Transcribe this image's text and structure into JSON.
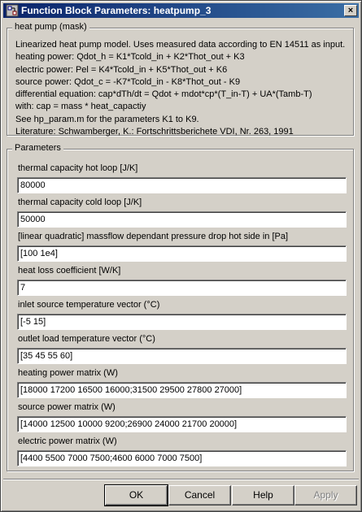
{
  "window": {
    "title": "Function Block Parameters: heatpump_3",
    "close_glyph": "×"
  },
  "mask": {
    "group_label": "heat pump (mask)",
    "description_lines": [
      "Linearized heat pump model. Uses measured data according to EN 14511 as input.",
      "heating power: Qdot_h = K1*Tcold_in + K2*Thot_out + K3",
      "electric power: Pel = K4*Tcold_in + K5*Thot_out + K6",
      "source power: Qdot_c = -K7*Tcold_in - K8*Thot_out - K9",
      "differential equation: cap*dTh/dt = Qdot + mdot*cp*(T_in-T) + UA*(Tamb-T)",
      "with: cap = mass * heat_capactiy",
      "See hp_param.m for the parameters K1 to K9.",
      "Literature: Schwamberger, K.: Fortschrittsberichete VDI, Nr. 263, 1991"
    ]
  },
  "parameters": {
    "group_label": "Parameters",
    "fields": [
      {
        "label": "thermal capacity hot loop [J/K]",
        "value": "80000"
      },
      {
        "label": "thermal capacity cold loop [J/K]",
        "value": "50000"
      },
      {
        "label": "[linear quadratic] massflow dependant pressure drop hot side in [Pa]",
        "value": "[100 1e4]"
      },
      {
        "label": "heat loss coefficient [W/K]",
        "value": "7"
      },
      {
        "label": "inlet source temperature vector (°C)",
        "value": "[-5 15]"
      },
      {
        "label": "outlet load temperature vector (°C)",
        "value": "[35 45 55 60]"
      },
      {
        "label": "heating power matrix (W)",
        "value": "[18000 17200 16500 16000;31500 29500 27800 27000]"
      },
      {
        "label": "source power matrix (W)",
        "value": "[14000 12500 10000 9200;26900 24000 21700 20000]"
      },
      {
        "label": "electric power matrix (W)",
        "value": "[4400 5500 7000 7500;4600 6000 7000 7500]"
      }
    ]
  },
  "buttons": {
    "ok": "OK",
    "cancel": "Cancel",
    "help": "Help",
    "apply": "Apply"
  }
}
